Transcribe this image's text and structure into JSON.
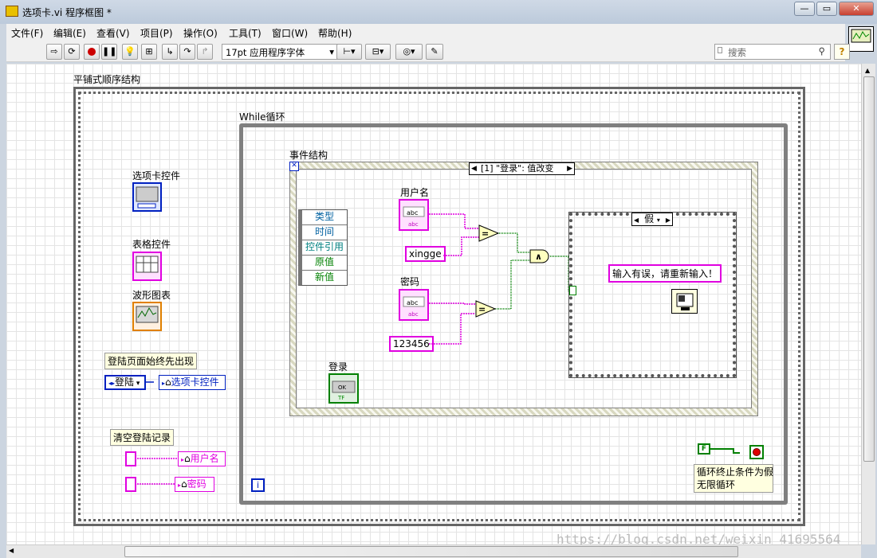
{
  "window": {
    "title": "选项卡.vi 程序框图 *",
    "btn_min": "—",
    "btn_max": "▭",
    "btn_close": "✕"
  },
  "menus": [
    "文件(F)",
    "编辑(E)",
    "查看(V)",
    "项目(P)",
    "操作(O)",
    "工具(T)",
    "窗口(W)",
    "帮助(H)"
  ],
  "toolbar": {
    "font": "17pt 应用程序字体",
    "search_placeholder": "搜索",
    "help": "?"
  },
  "diagram": {
    "flat_sequence_label": "平铺式顺序结构",
    "while_label": "While循环",
    "event_label": "事件结构",
    "event_case": "[1] \"登录\": 值改变",
    "event_data": [
      "类型",
      "时间",
      "控件引用",
      "原值",
      "新值"
    ],
    "case_selector": "假",
    "tab_control_label": "选项卡控件",
    "table_label": "表格控件",
    "waveform_label": "波形图表",
    "comment_login_first": "登陆页面始终先出现",
    "enum_login": "登陆",
    "tab_local_var": "选项卡控件",
    "comment_clear": "清空登陆记录",
    "local_user": "用户名",
    "local_pwd": "密码",
    "username_label": "用户名",
    "password_label": "密码",
    "username_const": "xingge",
    "password_const": "123456",
    "login_label": "登录",
    "error_message": "输入有误，请重新输入！",
    "false_const": "F",
    "loop_comment_1": "循环终止条件为假",
    "loop_comment_2": "无限循环",
    "iteration": "i",
    "and_symbol": "∧",
    "eq_symbol": "="
  },
  "watermark": "https://blog.csdn.net/weixin_41695564",
  "colors": {
    "string_wire": "#e000e0",
    "bool_wire": "#008000",
    "enum_wire": "#0020c0",
    "window_bg": "#ccd5e0"
  }
}
